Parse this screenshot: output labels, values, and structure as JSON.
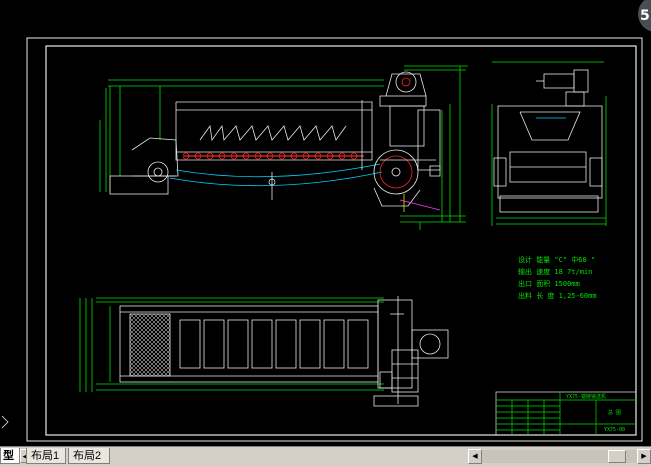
{
  "tabs": [
    {
      "label": "型",
      "active": true
    },
    {
      "label": "布局1",
      "active": false
    },
    {
      "label": "布局2",
      "active": false
    }
  ],
  "corner_badge": "5",
  "drawing": {
    "title_block_name": "YX75-锚链输送机",
    "title_block_code": "YX75-00",
    "title_block_mark": "总 图",
    "spec_lines": [
      "设计  能量  \"C\" 中60 \"",
      "输出 速度 18  7t/min",
      "出口 面积 1500mm",
      "出料 长 度  1,25-60mm"
    ]
  },
  "colors": {
    "frame": "#ffffff",
    "line_white": "#e8e8e8",
    "line_green": "#00e000",
    "line_red": "#ff2020",
    "line_cyan": "#00d8ff",
    "line_yellow": "#e0e000",
    "line_magenta": "#ff40ff"
  }
}
